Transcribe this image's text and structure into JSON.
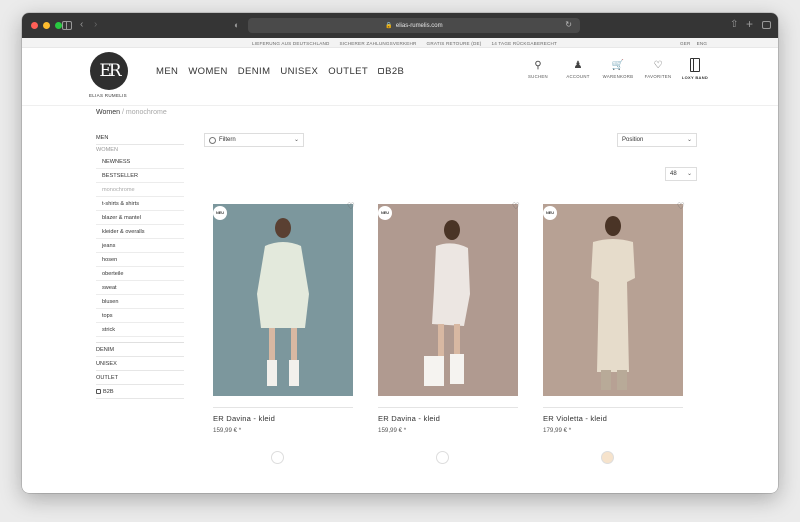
{
  "browser": {
    "url": "elias-rumelis.com"
  },
  "infobar": {
    "messages": [
      "LIEFERUNG AUS DEUTSCHLAND",
      "SICHERER ZAHLUNGSVERKEHR",
      "GRATIS RETOURE (DE)",
      "14 TAGE RÜCKGABERECHT"
    ],
    "languages": [
      "GER",
      "ENG"
    ]
  },
  "header": {
    "logo_mark": "ER",
    "logo_text": "ELIAS RUMELIS",
    "nav": [
      "MEN",
      "WOMEN",
      "DENIM",
      "UNISEX",
      "OUTLET"
    ],
    "nav_b2b": "B2B",
    "tools": [
      {
        "label": "SUCHEN",
        "icon": "search-icon"
      },
      {
        "label": "ACCOUNT",
        "icon": "user-icon"
      },
      {
        "label": "WARENKORB",
        "icon": "cart-icon"
      },
      {
        "label": "FAVORITEN",
        "icon": "heart-icon"
      }
    ],
    "loxy_label": "LOXY BAND"
  },
  "breadcrumb": {
    "parent": "Women",
    "separator": "/",
    "current": "monochrome"
  },
  "category_nav": {
    "men": "MEN",
    "women": "WOMEN",
    "women_items": [
      "NEWNESS",
      "BESTSELLER",
      "monochrome",
      "t-shirts & shirts",
      "blazer & mantel",
      "kleider & overalls",
      "jeans",
      "hosen",
      "oberteile",
      "sweat",
      "blusen",
      "tops",
      "strick"
    ],
    "active_item": "monochrome",
    "other": [
      "DENIM",
      "UNISEX",
      "OUTLET"
    ],
    "b2b": "B2B"
  },
  "toolbar": {
    "filter_label": "Filtern",
    "sort_value": "Position",
    "per_page_value": "48"
  },
  "products": [
    {
      "badge": "NEU",
      "name": "ER Davina - kleid",
      "price": "159,99 € *",
      "bg": "#7c979d",
      "dress": "#e3e9dc",
      "swatch": "#ffffff"
    },
    {
      "badge": "NEU",
      "name": "ER Davina - kleid",
      "price": "159,99 € *",
      "bg": "#b09a90",
      "dress": "#ece6e2",
      "swatch": "#ffffff"
    },
    {
      "badge": "NEU",
      "name": "ER Violetta - kleid",
      "price": "179,99 € *",
      "bg": "#b7a194",
      "dress": "#e6dccb",
      "swatch": "#f6e3cc"
    }
  ]
}
